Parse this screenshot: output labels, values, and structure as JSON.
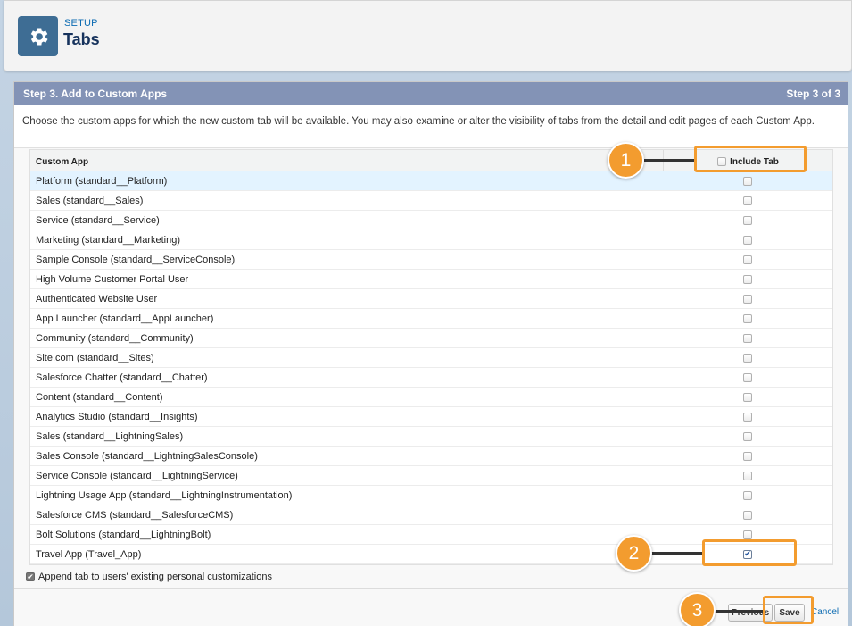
{
  "header": {
    "eyebrow": "SETUP",
    "title": "Tabs",
    "icon": "gear-icon"
  },
  "step": {
    "title": "Step 3. Add to Custom Apps",
    "counter": "Step 3 of 3"
  },
  "description": "Choose the custom apps for which the new custom tab will be available. You may also examine or alter the visibility of tabs from the detail and edit pages of each Custom App.",
  "table": {
    "col_app": "Custom App",
    "col_include": "Include Tab",
    "include_all_checked": false,
    "rows": [
      {
        "label": "Platform (standard__Platform)",
        "checked": false,
        "highlight": true
      },
      {
        "label": "Sales (standard__Sales)",
        "checked": false
      },
      {
        "label": "Service (standard__Service)",
        "checked": false
      },
      {
        "label": "Marketing (standard__Marketing)",
        "checked": false
      },
      {
        "label": "Sample Console (standard__ServiceConsole)",
        "checked": false
      },
      {
        "label": "High Volume Customer Portal User",
        "checked": false
      },
      {
        "label": "Authenticated Website User",
        "checked": false
      },
      {
        "label": "App Launcher (standard__AppLauncher)",
        "checked": false
      },
      {
        "label": "Community (standard__Community)",
        "checked": false
      },
      {
        "label": "Site.com (standard__Sites)",
        "checked": false
      },
      {
        "label": "Salesforce Chatter (standard__Chatter)",
        "checked": false
      },
      {
        "label": "Content (standard__Content)",
        "checked": false
      },
      {
        "label": "Analytics Studio (standard__Insights)",
        "checked": false
      },
      {
        "label": "Sales (standard__LightningSales)",
        "checked": false
      },
      {
        "label": "Sales Console (standard__LightningSalesConsole)",
        "checked": false
      },
      {
        "label": "Service Console (standard__LightningService)",
        "checked": false
      },
      {
        "label": "Lightning Usage App (standard__LightningInstrumentation)",
        "checked": false
      },
      {
        "label": "Salesforce CMS (standard__SalesforceCMS)",
        "checked": false
      },
      {
        "label": "Bolt Solutions (standard__LightningBolt)",
        "checked": false
      },
      {
        "label": "Travel App (Travel_App)",
        "checked": true
      }
    ]
  },
  "append_option": {
    "label": "Append tab to users' existing personal customizations",
    "checked": true
  },
  "footer": {
    "previous_label": "Previous",
    "save_label": "Save",
    "cancel_label": "Cancel"
  },
  "callouts": [
    "1",
    "2",
    "3"
  ],
  "colors": {
    "step_bar": "#8393b6",
    "callout": "#f39c2f",
    "header_icon_bg": "#3e6d94",
    "row_highlight": "#e3f3ff"
  }
}
